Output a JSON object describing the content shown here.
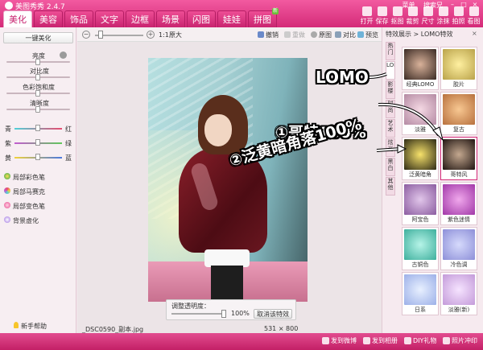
{
  "app": {
    "title": "美图秀秀 2.4.7"
  },
  "window_links": [
    "菜单",
    "搜索兄"
  ],
  "window_buttons": [
    "–",
    "□",
    "×"
  ],
  "tabs": [
    "美化",
    "美容",
    "饰品",
    "文字",
    "边框",
    "场景",
    "闪图",
    "娃娃",
    "拼图"
  ],
  "tab_new_badge": "新",
  "toolbar": [
    "打开",
    "保存",
    "抠图",
    "裁剪",
    "尺寸",
    "涂抹",
    "拍照",
    "看图"
  ],
  "left": {
    "one_click": "一键美化",
    "sliders": [
      "亮度",
      "对比度",
      "色彩饱和度",
      "清晰度"
    ],
    "colors": [
      {
        "left": "青",
        "right": "红"
      },
      {
        "left": "紫",
        "right": "绿"
      },
      {
        "left": "黄",
        "right": "蓝"
      }
    ],
    "tools": [
      "局部彩色笔",
      "局部马赛克",
      "局部变色笔",
      "背景虚化"
    ],
    "help": "新手帮助"
  },
  "center": {
    "zoom_text": "1:1原大",
    "undo": "撤销",
    "redo": "重做",
    "original": "原图",
    "compare": "对比",
    "preview": "预览",
    "opacity_label": "调整透明度：",
    "opacity_value": "100%",
    "cancel_effect": "取消该特效",
    "filename": "_DSC0590_副本.jpg",
    "image_size": "531 × 800"
  },
  "right": {
    "header": "特效展示 > LOMO特效",
    "close": "×",
    "categories": [
      "热门",
      "LOMO",
      "影楼",
      "时尚",
      "艺术",
      "炫光",
      "黑白",
      "其他"
    ],
    "thumbs": [
      "经典LOMO",
      "胶片",
      "淡雅",
      "复古",
      "泛黄暗角",
      "哥特风",
      "阿宝色",
      "紫色迷情",
      "古铜色",
      "冷色调",
      "日系",
      "淡雅(新)"
    ]
  },
  "annotations": {
    "lomo": "LOMO",
    "step1": "①哥特100%",
    "step2": "②泛黄暗角落100%"
  },
  "status": [
    "发到微博",
    "发到相册",
    "DIY礼物",
    "照片冲印"
  ],
  "colors": {
    "accent": "#d42a78",
    "accent_light": "#f25aa0"
  }
}
